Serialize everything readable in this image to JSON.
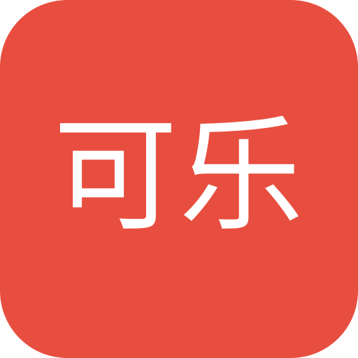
{
  "icon": {
    "label": "可乐",
    "background_color": "#e84e3f",
    "text_color": "#ffffff"
  }
}
